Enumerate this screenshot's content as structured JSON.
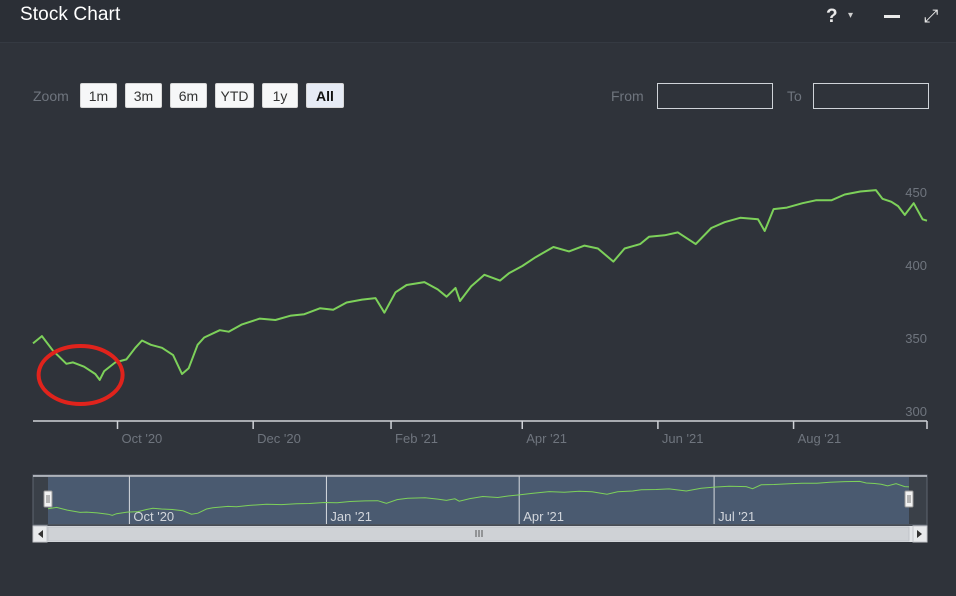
{
  "window": {
    "title": "Stock Chart",
    "help_glyph": "?",
    "caret_glyph": "▾",
    "expand_glyph": "⤢"
  },
  "toolbar": {
    "zoom_label": "Zoom",
    "zoom_buttons": [
      {
        "label": "1m",
        "active": false
      },
      {
        "label": "3m",
        "active": false
      },
      {
        "label": "6m",
        "active": false
      },
      {
        "label": "YTD",
        "active": false
      },
      {
        "label": "1y",
        "active": false
      },
      {
        "label": "All",
        "active": true
      }
    ],
    "from_label": "From",
    "to_label": "To",
    "from_value": "",
    "to_value": ""
  },
  "colors": {
    "background": "#2f333a",
    "line": "#7dd15a",
    "axis_text": "#6f757e",
    "highlight_circle": "#e0231c",
    "navigator_fill": "#4a5a70"
  },
  "chart_data": {
    "type": "line",
    "title": "",
    "xlabel": "",
    "ylabel": "",
    "x_range": [
      "2020-08-24",
      "2021-09-30"
    ],
    "ylim": [
      300,
      460
    ],
    "y_ticks": [
      300,
      350,
      400,
      450
    ],
    "x_ticks": [
      {
        "label": "Oct '20",
        "date": "2020-10-01"
      },
      {
        "label": "Dec '20",
        "date": "2020-12-01"
      },
      {
        "label": "Feb '21",
        "date": "2021-02-01"
      },
      {
        "label": "Apr '21",
        "date": "2021-04-01"
      },
      {
        "label": "Jun '21",
        "date": "2021-06-01"
      },
      {
        "label": "Aug '21",
        "date": "2021-08-01"
      }
    ],
    "navigator_ticks": [
      {
        "label": "Oct '20",
        "date": "2020-10-01"
      },
      {
        "label": "Jan '21",
        "date": "2021-01-01"
      },
      {
        "label": "Apr '21",
        "date": "2021-04-01"
      },
      {
        "label": "Jul '21",
        "date": "2021-07-01"
      }
    ],
    "series": [
      {
        "values": [
          [
            "2020-08-24",
            347
          ],
          [
            "2020-08-28",
            352
          ],
          [
            "2020-09-02",
            342
          ],
          [
            "2020-09-08",
            333
          ],
          [
            "2020-09-11",
            334
          ],
          [
            "2020-09-16",
            331
          ],
          [
            "2020-09-21",
            326
          ],
          [
            "2020-09-23",
            322
          ],
          [
            "2020-09-25",
            328
          ],
          [
            "2020-09-30",
            334
          ],
          [
            "2020-10-05",
            336
          ],
          [
            "2020-10-09",
            344
          ],
          [
            "2020-10-12",
            349
          ],
          [
            "2020-10-16",
            346
          ],
          [
            "2020-10-21",
            344
          ],
          [
            "2020-10-26",
            339
          ],
          [
            "2020-10-30",
            326
          ],
          [
            "2020-11-02",
            330
          ],
          [
            "2020-11-06",
            346
          ],
          [
            "2020-11-09",
            351
          ],
          [
            "2020-11-16",
            356
          ],
          [
            "2020-11-20",
            355
          ],
          [
            "2020-11-26",
            360
          ],
          [
            "2020-12-04",
            364
          ],
          [
            "2020-12-11",
            363
          ],
          [
            "2020-12-18",
            366
          ],
          [
            "2020-12-24",
            367
          ],
          [
            "2020-12-31",
            371
          ],
          [
            "2021-01-06",
            370
          ],
          [
            "2021-01-12",
            375
          ],
          [
            "2021-01-19",
            377
          ],
          [
            "2021-01-25",
            378
          ],
          [
            "2021-01-29",
            368
          ],
          [
            "2021-02-03",
            382
          ],
          [
            "2021-02-08",
            387
          ],
          [
            "2021-02-16",
            389
          ],
          [
            "2021-02-22",
            384
          ],
          [
            "2021-02-26",
            379
          ],
          [
            "2021-03-02",
            385
          ],
          [
            "2021-03-04",
            376
          ],
          [
            "2021-03-09",
            386
          ],
          [
            "2021-03-15",
            394
          ],
          [
            "2021-03-22",
            390
          ],
          [
            "2021-03-26",
            395
          ],
          [
            "2021-04-01",
            400
          ],
          [
            "2021-04-07",
            406
          ],
          [
            "2021-04-15",
            413
          ],
          [
            "2021-04-22",
            410
          ],
          [
            "2021-04-29",
            414
          ],
          [
            "2021-05-05",
            412
          ],
          [
            "2021-05-12",
            403
          ],
          [
            "2021-05-17",
            412
          ],
          [
            "2021-05-24",
            415
          ],
          [
            "2021-05-28",
            420
          ],
          [
            "2021-06-04",
            421
          ],
          [
            "2021-06-10",
            423
          ],
          [
            "2021-06-18",
            415
          ],
          [
            "2021-06-25",
            426
          ],
          [
            "2021-07-01",
            430
          ],
          [
            "2021-07-08",
            433
          ],
          [
            "2021-07-16",
            432
          ],
          [
            "2021-07-19",
            424
          ],
          [
            "2021-07-23",
            439
          ],
          [
            "2021-07-29",
            440
          ],
          [
            "2021-08-05",
            443
          ],
          [
            "2021-08-11",
            445
          ],
          [
            "2021-08-18",
            445
          ],
          [
            "2021-08-24",
            449
          ],
          [
            "2021-08-31",
            451
          ],
          [
            "2021-09-07",
            452
          ],
          [
            "2021-09-10",
            446
          ],
          [
            "2021-09-14",
            444
          ],
          [
            "2021-09-17",
            441
          ],
          [
            "2021-09-20",
            435
          ],
          [
            "2021-09-24",
            443
          ],
          [
            "2021-09-28",
            432
          ],
          [
            "2021-09-30",
            431
          ]
        ]
      }
    ],
    "highlight": {
      "shape": "ellipse",
      "start": "2020-09-01",
      "end": "2020-10-05"
    },
    "grid": false,
    "legend": "none"
  }
}
